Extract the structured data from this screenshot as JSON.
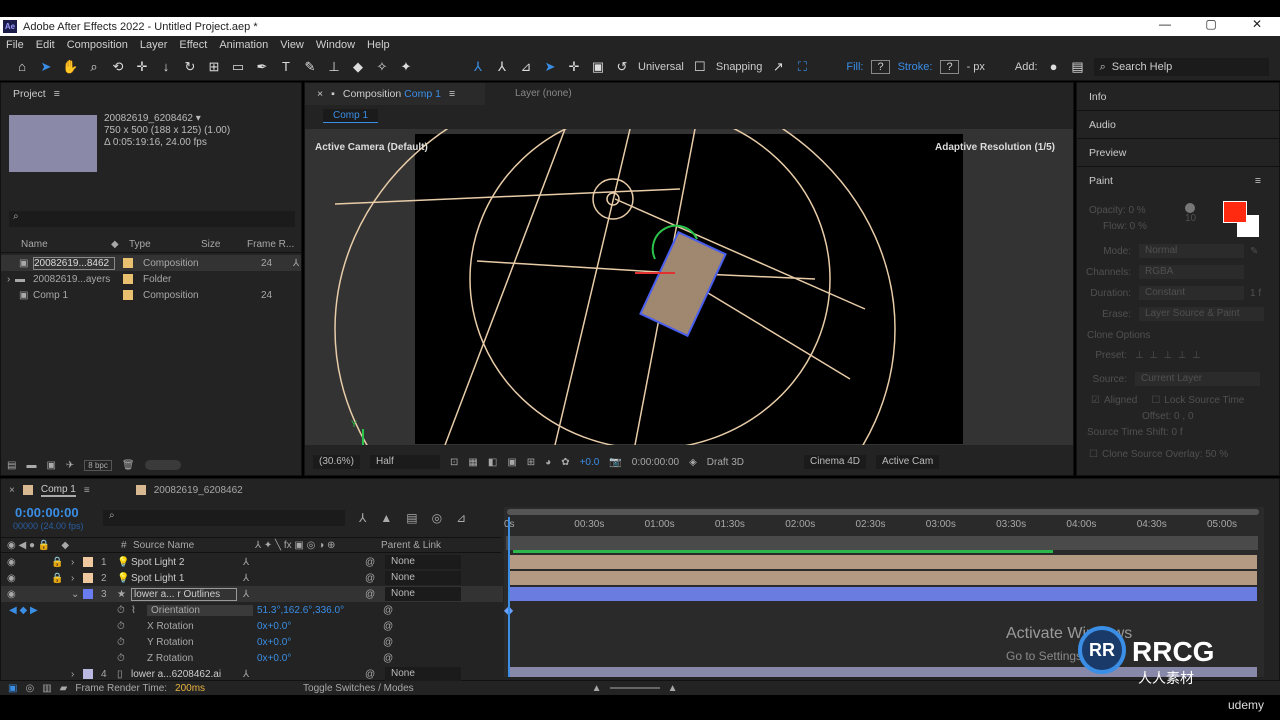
{
  "window": {
    "title": "Adobe After Effects 2022 - Untitled Project.aep *",
    "logo": "Ae",
    "controls": [
      "—",
      "▢",
      "✕"
    ]
  },
  "menu": [
    "File",
    "Edit",
    "Composition",
    "Layer",
    "Effect",
    "Animation",
    "View",
    "Window",
    "Help"
  ],
  "toolbar": {
    "axis_mode": "Universal",
    "snapping": "Snapping",
    "fill_label": "Fill:",
    "fill_value": "?",
    "stroke_label": "Stroke:",
    "stroke_value": "?",
    "stroke_unit": "- px",
    "add_label": "Add:",
    "search_placeholder": "Search Help"
  },
  "project": {
    "tab": "Project",
    "item_name": "20082619_6208462 ▾",
    "item_dims": "750 x 500  (188 x 125) (1.00)",
    "item_dur": "Δ 0:05:19:16, 24.00 fps",
    "columns": [
      "Name",
      "Type",
      "Size",
      "Frame R..."
    ],
    "rows": [
      {
        "name": "20082619...8462",
        "type": "Composition",
        "rate": "24",
        "color": "#e8c070"
      },
      {
        "name": "20082619...ayers",
        "type": "Folder",
        "rate": "",
        "color": "#e8c070"
      },
      {
        "name": "Comp 1",
        "type": "Composition",
        "rate": "24",
        "color": "#e8c070"
      }
    ],
    "bpc": "8 bpc"
  },
  "comp": {
    "tab": "Composition",
    "tab_name": "Comp 1",
    "layer_tab": "Layer (none)",
    "breadcrumb": "Comp 1",
    "camera_label": "Active Camera (Default)",
    "resolution_label": "Adaptive Resolution (1/5)",
    "footer": {
      "zoom": "(30.6%)",
      "quality": "Half",
      "exposure": "+0.0",
      "timecode": "0:00:00:00",
      "renderer": "Draft 3D",
      "engine": "Cinema 4D",
      "view": "Active Cam"
    }
  },
  "right": {
    "tabs": [
      "Info",
      "Audio",
      "Preview"
    ],
    "paint": {
      "title": "Paint",
      "opacity": "Opacity: 0 %",
      "flow": "Flow: 0 %",
      "brush_size": "10",
      "fg_color": "#ff2a10",
      "bg_color": "#ffffff",
      "mode_label": "Mode:",
      "mode": "Normal",
      "channels_label": "Channels:",
      "channels": "RGBA",
      "duration_label": "Duration:",
      "duration": "Constant",
      "duration_frames": "1 f",
      "erase_label": "Erase:",
      "erase": "Layer Source & Paint",
      "clone_options": "Clone Options",
      "preset_label": "Preset:",
      "source_label": "Source:",
      "source": "Current Layer",
      "aligned": "Aligned",
      "lock_source": "Lock Source Time",
      "offset": "Offset: 0 , 0",
      "time_shift": "Source Time Shift: 0 f",
      "overlay": "Clone Source Overlay: 50 %"
    }
  },
  "timeline": {
    "tabs": [
      {
        "name": "Comp 1"
      },
      {
        "name": "20082619_6208462"
      }
    ],
    "timecode": "0:00:00:00",
    "frame_info": "00000 (24.00 fps)",
    "col_source": "Source Name",
    "col_parent": "Parent & Link",
    "col_num": "#",
    "ruler": [
      "0s",
      "00:30s",
      "01:00s",
      "01:30s",
      "02:00s",
      "02:30s",
      "03:00s",
      "03:30s",
      "04:00s",
      "04:30s",
      "05:00s"
    ],
    "layers": [
      {
        "num": "1",
        "name": "Spot Light 2",
        "color": "#f0c8a0",
        "parent": "None",
        "icon": "light-bulb-icon"
      },
      {
        "num": "2",
        "name": "Spot Light 1",
        "color": "#f0c8a0",
        "parent": "None",
        "icon": "light-bulb-icon"
      },
      {
        "num": "3",
        "name": "lower a... r Outlines",
        "color": "#6a7cf0",
        "parent": "None",
        "icon": "star-icon"
      },
      {
        "num": "4",
        "name": "lower a...6208462.ai",
        "color": "#b8b8e0",
        "parent": "None",
        "icon": "file-icon"
      }
    ],
    "props": [
      {
        "name": "Orientation",
        "value": "51.3°,162.6°,336.0°"
      },
      {
        "name": "X Rotation",
        "value": "0x+0.0°"
      },
      {
        "name": "Y Rotation",
        "value": "0x+0.0°"
      },
      {
        "name": "Z Rotation",
        "value": "0x+0.0°"
      }
    ],
    "render_label": "Frame Render Time:",
    "render_time": "200ms",
    "toggle": "Toggle Switches / Modes"
  },
  "watermark": {
    "activate": "Activate Windows",
    "goto": "Go to Settings",
    "brand": "RRCG",
    "brand_cn": "人人素材",
    "udemy": "udemy"
  }
}
